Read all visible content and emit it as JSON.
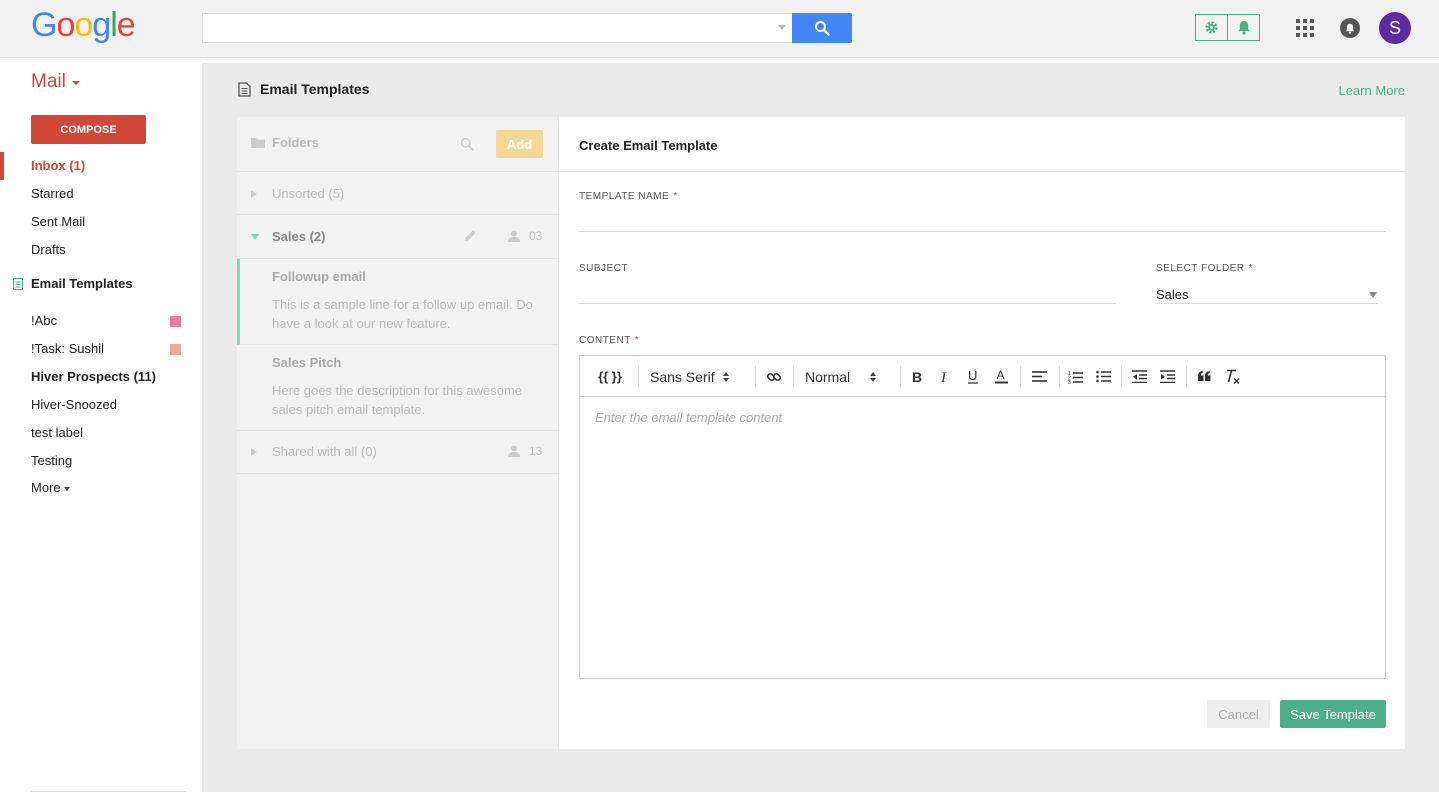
{
  "header": {
    "logo": [
      "G",
      "o",
      "o",
      "g",
      "l",
      "e"
    ],
    "logo_colors": [
      "#4285f4",
      "#ea4335",
      "#fbbc05",
      "#4285f4",
      "#34a853",
      "#ea4335"
    ],
    "search_value": "",
    "avatar_initial": "S",
    "icons": [
      "search-icon",
      "gear-icon",
      "bell-icon",
      "apps-icon",
      "notifications-icon"
    ]
  },
  "sidebar": {
    "mail_label": "Mail",
    "compose_label": "COMPOSE",
    "items": [
      {
        "label": "Inbox (1)"
      },
      {
        "label": "Starred"
      },
      {
        "label": "Sent Mail"
      },
      {
        "label": "Drafts"
      },
      {
        "label": "Email Templates"
      },
      {
        "label": "!Abc",
        "color": "#e879a0"
      },
      {
        "label": "!Task: Sushil",
        "color": "#f0a898"
      },
      {
        "label": "Hiver Prospects (11)"
      },
      {
        "label": "Hiver-Snoozed"
      },
      {
        "label": "test label"
      },
      {
        "label": "Testing"
      },
      {
        "label": "More"
      }
    ]
  },
  "page": {
    "title": "Email Templates",
    "learn_more": "Learn More"
  },
  "folders": {
    "title": "Folders",
    "add_label": "Add",
    "unsorted": {
      "label": "Unsorted (5)"
    },
    "sales": {
      "label": "Sales (2)",
      "users": "03"
    },
    "templates": [
      {
        "name": "Followup email",
        "description": "This is a sample line for a follow up email. Do have a look at our new feature."
      },
      {
        "name": "Sales Pitch",
        "description": "Here goes the description for this awesome sales pitch email template."
      }
    ],
    "shared": {
      "label": "Shared with all (0)",
      "users": "13"
    }
  },
  "form": {
    "title": "Create Email Template",
    "template_name_label": "TEMPLATE NAME",
    "template_name_value": "",
    "subject_label": "SUBJECT",
    "subject_value": "",
    "select_folder_label": "SELECT FOLDER",
    "select_folder_value": "Sales",
    "content_label": "CONTENT",
    "required_mark": "*",
    "toolbar": {
      "variables": "{{ }}",
      "font": "Sans Serif",
      "size": "Normal"
    },
    "content_placeholder": "Enter the email template content",
    "cancel_label": "Cancel",
    "save_label": "Save Template"
  },
  "colors": {
    "accent_green": "#4caf89",
    "mail_red": "#d14836",
    "search_blue": "#4285f4",
    "add_yellow": "#f3d994",
    "avatar_purple": "#5b2ca3"
  }
}
